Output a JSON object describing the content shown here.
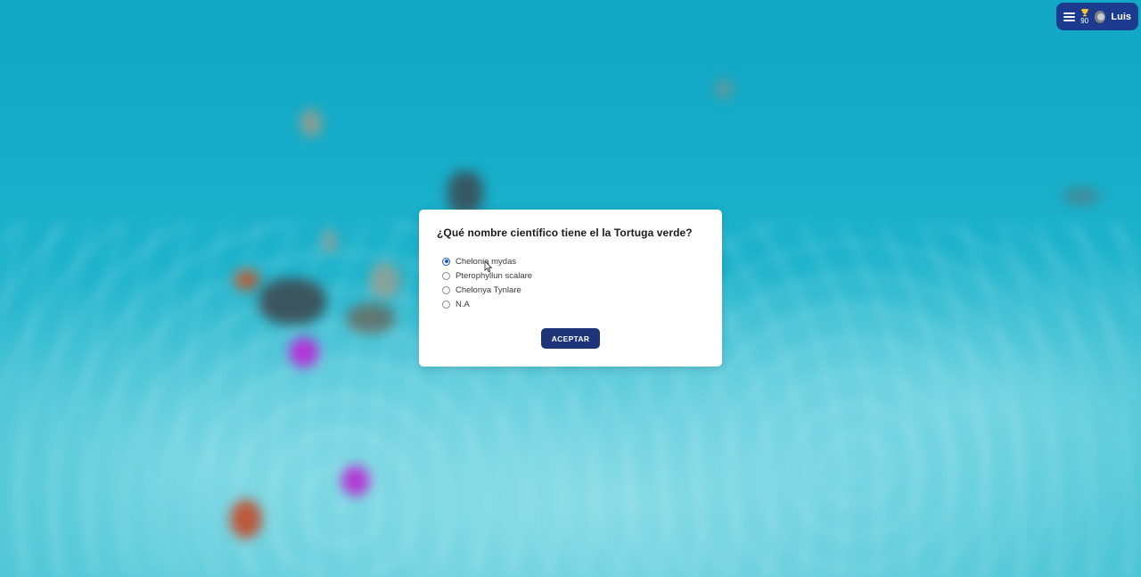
{
  "header": {
    "points": "90",
    "username": "Luis",
    "icons": {
      "menu": "menu-icon",
      "trophy": "trophy-icon",
      "avatar": "avatar"
    }
  },
  "quiz": {
    "question": "¿Qué nombre científico tiene el la Tortuga verde?",
    "options": [
      {
        "label": "Chelonia mydas",
        "selected": true
      },
      {
        "label": "Pterophyllun scalare",
        "selected": false
      },
      {
        "label": "Chelonya Tynlare",
        "selected": false
      },
      {
        "label": "N.A",
        "selected": false
      }
    ],
    "accept_label": "ACEPTAR"
  },
  "colors": {
    "accent": "#1d3b8e",
    "button": "#1d3479",
    "water": "#1eb3cc"
  }
}
